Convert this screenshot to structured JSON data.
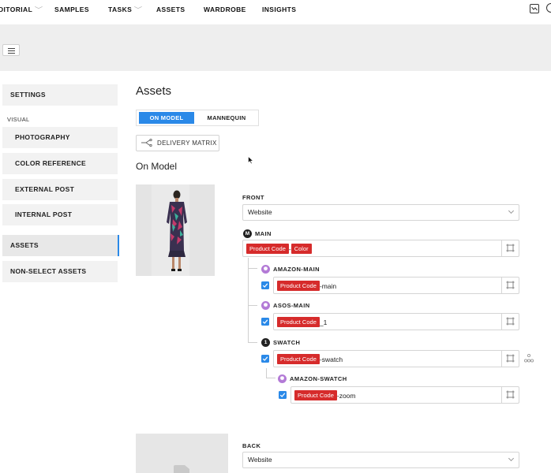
{
  "nav": {
    "items": [
      {
        "label": "DITORIAL",
        "dropdown": true
      },
      {
        "label": "SAMPLES",
        "dropdown": false
      },
      {
        "label": "TASKS",
        "dropdown": true
      },
      {
        "label": "ASSETS",
        "dropdown": false
      },
      {
        "label": "WARDROBE",
        "dropdown": false
      },
      {
        "label": "INSIGHTS",
        "dropdown": false
      }
    ],
    "right_icons": [
      "chart-icon",
      "user-icon"
    ]
  },
  "sidebar": {
    "settings": "SETTINGS",
    "section_visual": "VISUAL",
    "visual_items": [
      "PHOTOGRAPHY",
      "COLOR REFERENCE",
      "EXTERNAL POST",
      "INTERNAL POST"
    ],
    "assets": "ASSETS",
    "non_select": "NON-SELECT ASSETS",
    "active": "ASSETS"
  },
  "main": {
    "title": "Assets",
    "toggle": {
      "on_model": "ON MODEL",
      "mannequin": "MANNEQUIN",
      "selected": "ON MODEL"
    },
    "delivery_matrix": "DELIVERY MATRIX",
    "section_title": "On Model",
    "front": {
      "label": "FRONT",
      "select_value": "Website",
      "main": {
        "badge": "M",
        "label": "MAIN",
        "chips": [
          "Product Code",
          "Color"
        ],
        "separator": "-"
      },
      "amazon_main": {
        "label": "AMAZON-MAIN",
        "chip": "Product Code",
        "suffix": "-main",
        "checked": true
      },
      "asos_main": {
        "label": "ASOS-MAIN",
        "chip": "Product Code",
        "suffix": "_1",
        "checked": true
      },
      "swatch": {
        "badge": "1",
        "label": "SWATCH",
        "chip": "Product Code",
        "suffix": "-swatch",
        "checked": true
      },
      "amazon_swatch": {
        "label": "AMAZON-SWATCH",
        "chip": "Product Code",
        "suffix": "-zoom",
        "checked": true
      }
    },
    "back": {
      "label": "BACK",
      "select_value": "Website"
    }
  },
  "colors": {
    "accent": "#2a89e8",
    "chip": "#d62b2b",
    "purple_badge": "#b37ad6",
    "band": "#eeeeee"
  }
}
